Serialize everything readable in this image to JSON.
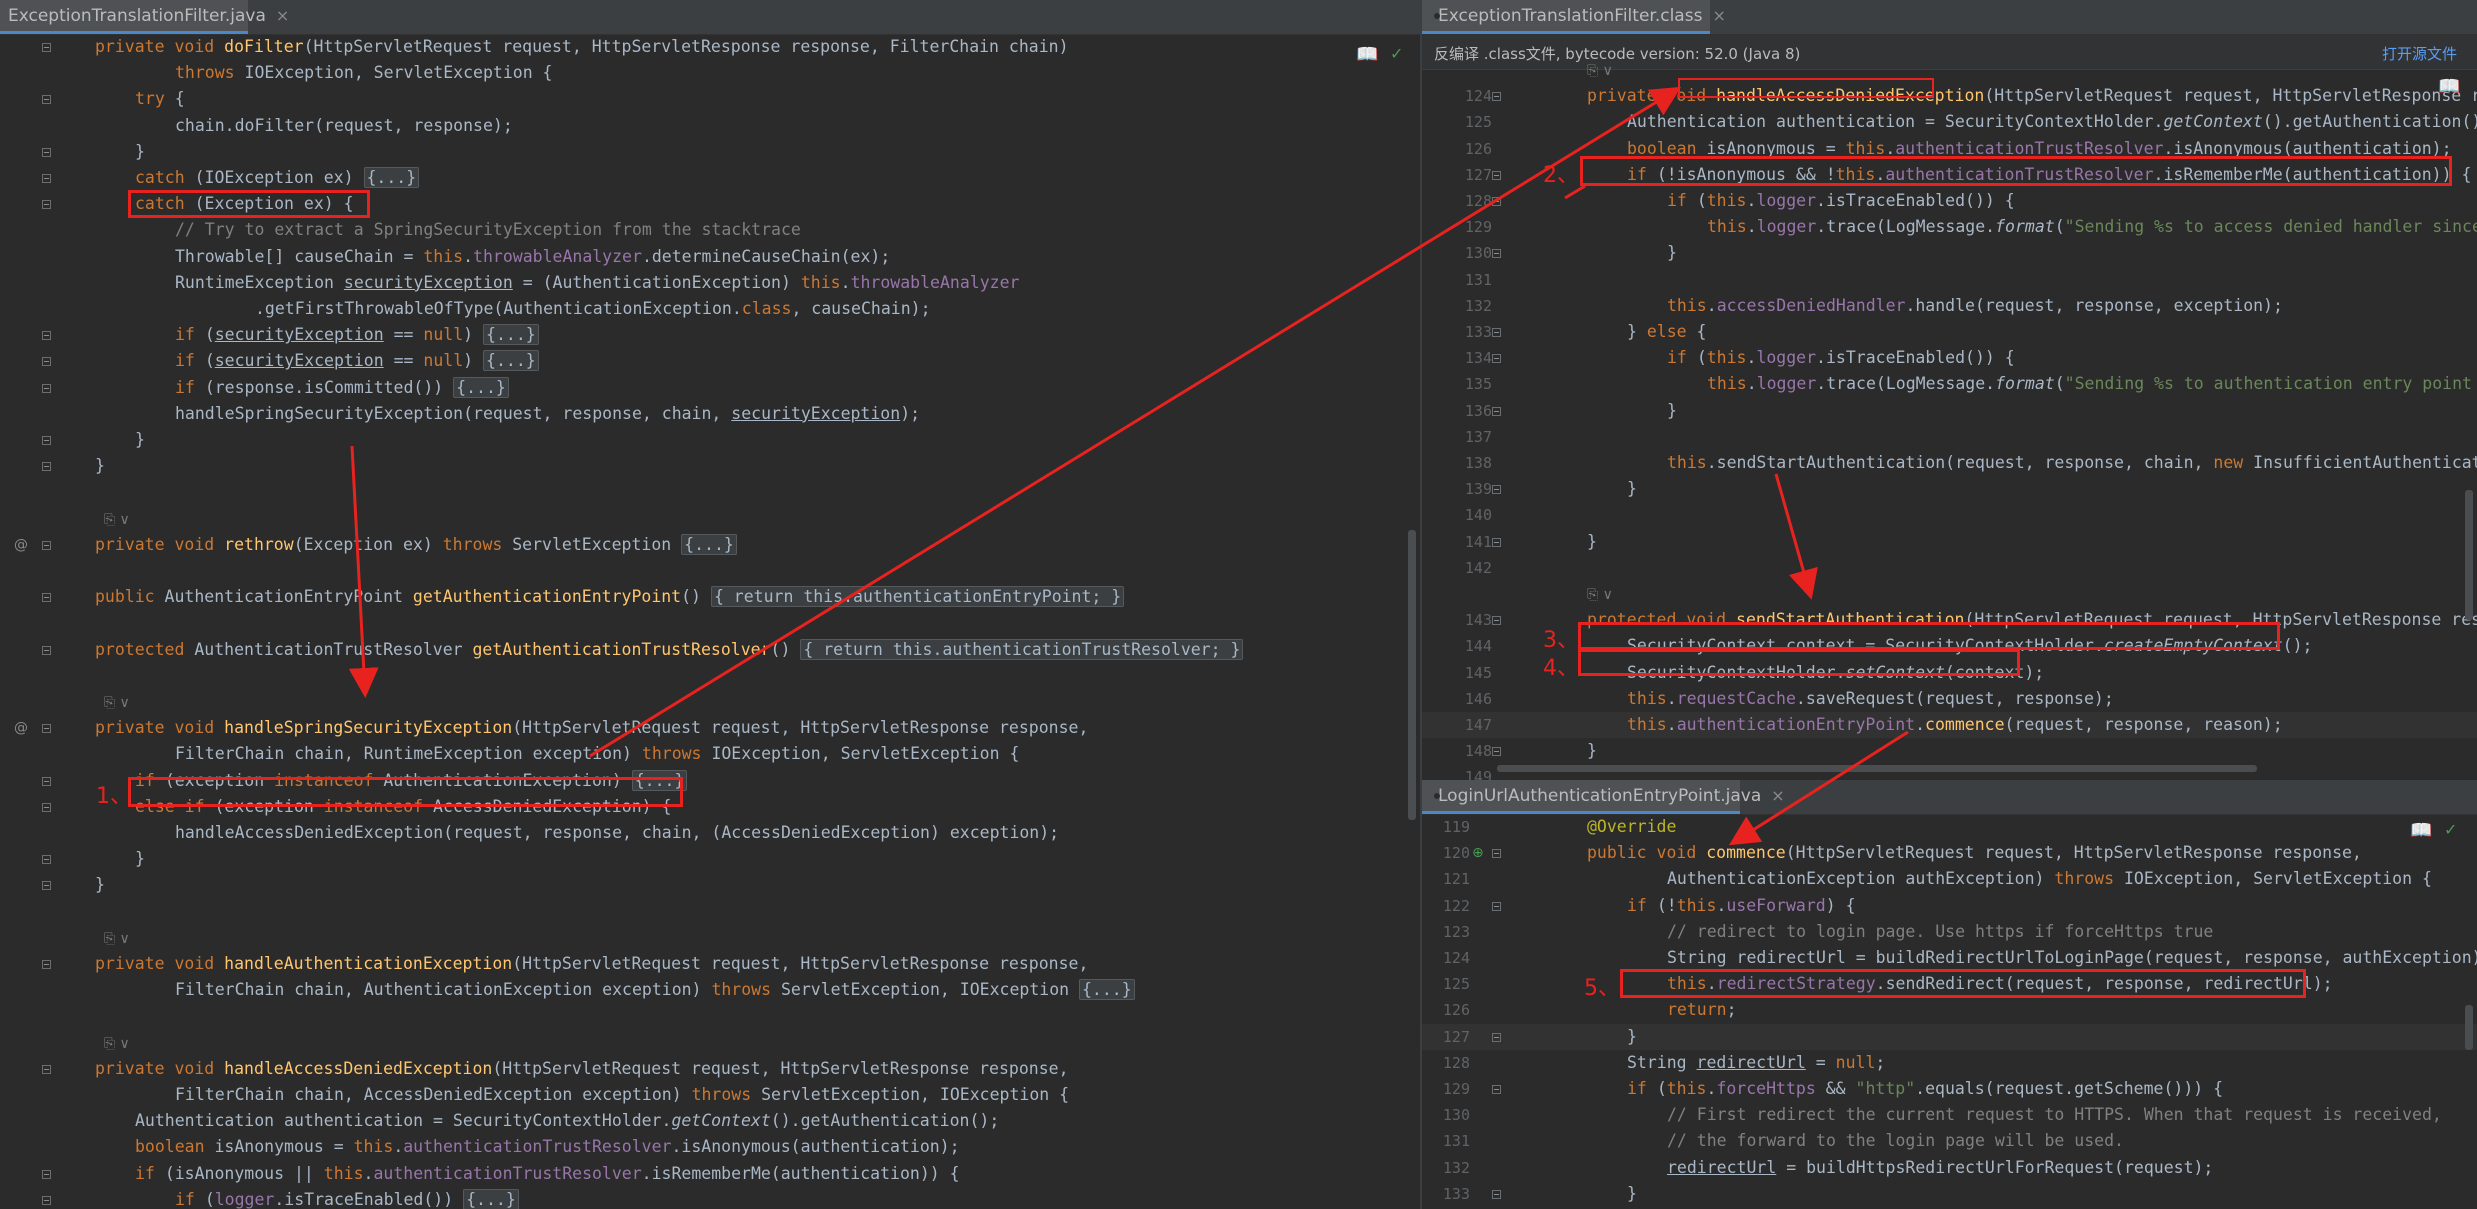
{
  "left_tab": {
    "title": "ExceptionTranslationFilter.java",
    "close": "×"
  },
  "right_top_tab": {
    "title": "ExceptionTranslationFilter.class",
    "close": "×"
  },
  "right_bottom_tab": {
    "title": "LoginUrlAuthenticationEntryPoint.java",
    "close": "×"
  },
  "decompile_bar": {
    "message": "反编译 .class文件, bytecode version: 52.0 (Java 8)",
    "link": "打开源文件"
  },
  "annotations": [
    "1、",
    "2、",
    "3、",
    "4、",
    "5、"
  ],
  "inlay_hint": "⎘ ∨",
  "colors": {
    "accent": "#4a88c7",
    "annotation_red": "#e8231f",
    "editor_bg": "#2b2b2b"
  }
}
